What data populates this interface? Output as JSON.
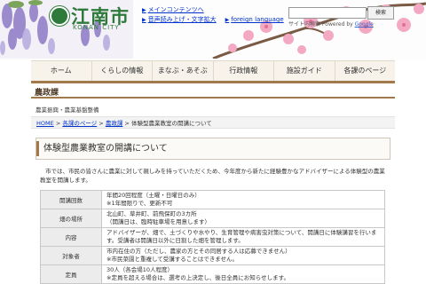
{
  "header": {
    "logo_text": "江南市",
    "logo_sub": "KONAN CITY",
    "links": {
      "main_content": "メインコンテンツへ",
      "read_aloud": "音声読み上げ・文字拡大",
      "foreign": "foreign language"
    },
    "search": {
      "placeholder": "",
      "button": "検索",
      "provider_label": "サイト内検索 Powered by",
      "provider": "Google"
    }
  },
  "nav": {
    "items": [
      {
        "label": "ホーム"
      },
      {
        "label": "くらしの情報"
      },
      {
        "label": "まなぶ・あそぶ"
      },
      {
        "label": "行政情報"
      },
      {
        "label": "施設ガイド"
      },
      {
        "label": "各課のページ"
      }
    ]
  },
  "section": {
    "title": "農政課",
    "subtitle": "農業振興・農業基盤整備"
  },
  "breadcrumb": {
    "items": [
      "HOME",
      "各課のページ",
      "農政課"
    ],
    "current": "体験型農業教室の開講について",
    "separator": ">"
  },
  "page": {
    "title": "体験型農業教室の開講について",
    "intro": "市では、市民の皆さんに農業に対して親しみを持っていただくため、今年度から新たに経験豊かなアドバイザーによる体験型の農業教室を開講します。"
  },
  "table": {
    "rows": [
      {
        "label": "開講回数",
        "lines": [
          "年間20回程度（土曜・日曜日のみ）",
          "※1年間限りで、更新不可"
        ]
      },
      {
        "label": "畑の場所",
        "lines": [
          "北山町、草井町、前飛保町の3カ所",
          "（開講日は、臨時駐車場を用意します）"
        ]
      },
      {
        "label": "内容",
        "lines": [
          "アドバイザーが、畑で、土づくりや水やり、生育管理や病害虫対策について、開講日に体験講習を行います。受講者は開講日以外に日割した畑を管理します。"
        ]
      },
      {
        "label": "対象者",
        "lines": [
          "市内在住の方（ただし、農家の方とその同居する人は応募できません）",
          "※市民菜園と重複して受講することはできません。"
        ]
      },
      {
        "label": "定員",
        "lines": [
          "30人（各会場10人程度）",
          "※定員を超える場合は、選考の上決定し、後日全員にお知らせします。"
        ]
      }
    ]
  },
  "colors": {
    "brand_green": "#2e7a3a",
    "nav_accent": "#a07a4c",
    "link": "#0033cc"
  }
}
